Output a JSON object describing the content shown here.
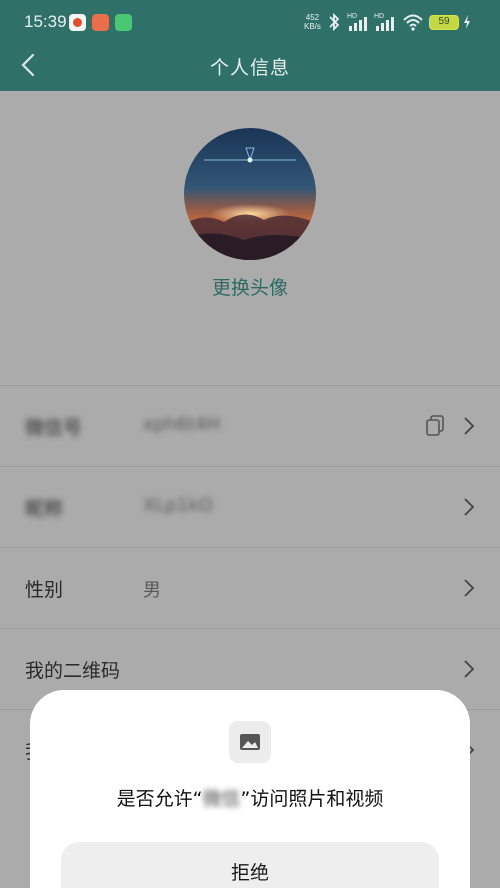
{
  "status_bar": {
    "time": "15:39",
    "net_speed_value": "452",
    "net_speed_unit": "KB/s",
    "battery": "59",
    "hd_label": "HD"
  },
  "header": {
    "title": "个人信息",
    "back_icon": "chevron-left-icon"
  },
  "profile": {
    "change_avatar_label": "更换头像"
  },
  "rows": [
    {
      "label": "微信号",
      "value": "xph6t4H",
      "icons": [
        "copy-icon",
        "chevron-right-icon"
      ],
      "obscured": true
    },
    {
      "label": "昵称",
      "value": "XLp1kO",
      "icons": [
        "chevron-right-icon"
      ],
      "obscured": true
    },
    {
      "label": "性别",
      "value": "男",
      "icons": [
        "chevron-right-icon"
      ],
      "obscured": false
    },
    {
      "label": "我的二维码",
      "value": "",
      "icons": [
        "chevron-right-icon"
      ],
      "obscured": false
    },
    {
      "label": "我",
      "value": "",
      "icons": [
        "chevron-right-icon"
      ],
      "obscured": false
    }
  ],
  "permission_sheet": {
    "icon": "image-icon",
    "message_prefix": "是否允许“",
    "app_name": "微信",
    "message_suffix": "”访问照片和视频",
    "deny_label": "拒绝"
  },
  "colors": {
    "header_bg": "#2f7068",
    "accent_text": "#2d6a63",
    "overlay_bg": "#ababab",
    "sheet_bg": "#ffffff"
  }
}
